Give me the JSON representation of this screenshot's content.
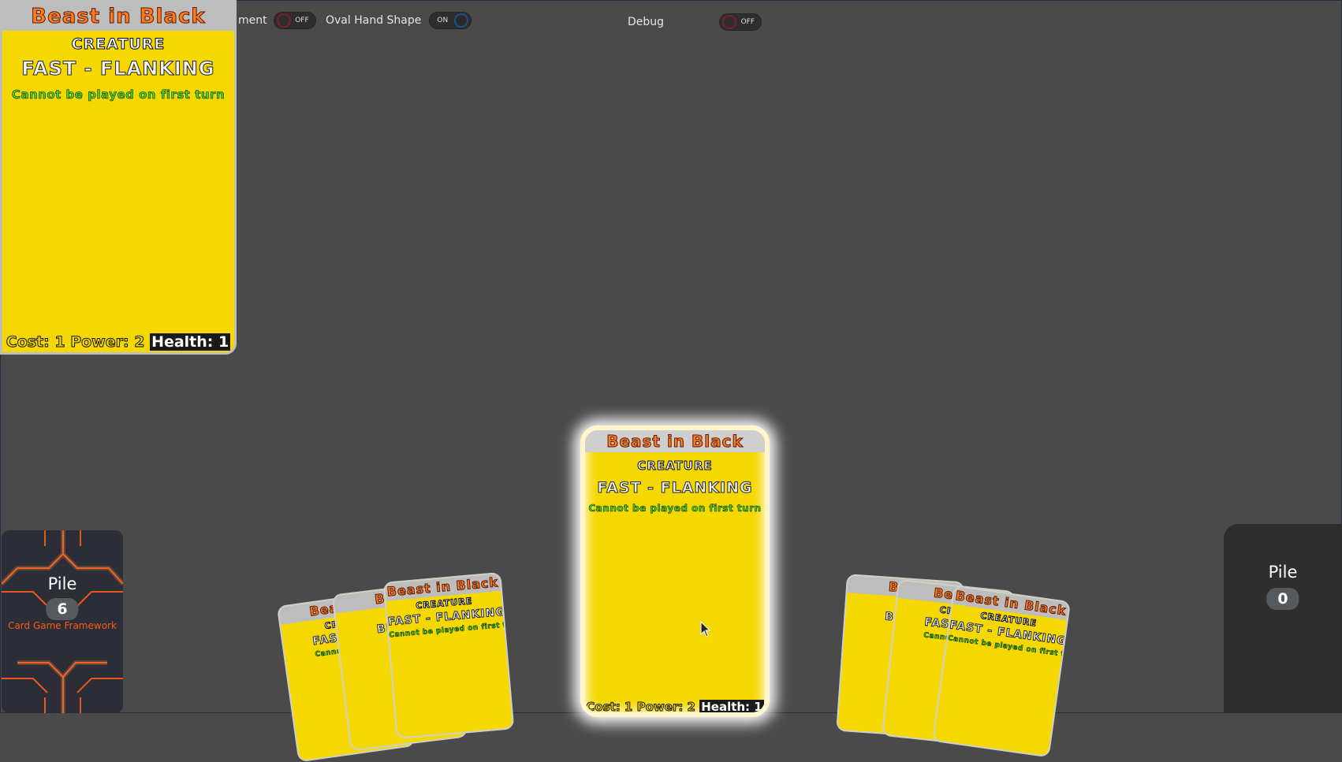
{
  "settings": {
    "toggle1": {
      "label": "ment",
      "state": "OFF"
    },
    "toggle2": {
      "label": "Oval Hand Shape",
      "state": "ON"
    },
    "toggle3": {
      "label": "Debug",
      "state": "OFF"
    }
  },
  "preview_card": {
    "name": "Beast in Black",
    "type": "CREATURE",
    "ability": "FAST - FLANKING",
    "rule": "Cannot be played on first turn",
    "stats": {
      "cost": "Cost: 1",
      "power": "Power: 2",
      "health": "Health: 1"
    }
  },
  "focused_card": {
    "name": "Beast in Black",
    "type": "CREATURE",
    "ability": "FAST - FLANKING",
    "rule": "Cannot be played on first turn",
    "stats": {
      "cost": "Cost: 1",
      "power": "Power: 2",
      "health": "Health: 1"
    }
  },
  "hand_left": [
    {
      "name": "Beast i",
      "type": "CREA",
      "ability": "FAST - F",
      "rule": "Cannot be pl"
    },
    {
      "name": "Batt",
      "type": "CR",
      "ability": "BRUT",
      "rule": ""
    },
    {
      "name": "Beast in Black",
      "type": "CREATURE",
      "ability": "FAST - FLANKING",
      "rule": "Cannot be played on first turn"
    }
  ],
  "hand_right": [
    {
      "name": "Batt",
      "type": "CR",
      "ability": "BRUT",
      "rule": ""
    },
    {
      "name": "Beast",
      "type": "CREA",
      "ability": "FAST - F",
      "rule": "Cannot be pl"
    },
    {
      "name": "Beast in Black",
      "type": "CREATURE",
      "ability": "FAST - FLANKING",
      "rule": "Cannot be played on first turn"
    }
  ],
  "deck_pile": {
    "title": "Pile",
    "count": "6",
    "brand": "Card Game Framework"
  },
  "discard_pile": {
    "title": "Pile",
    "count": "0"
  },
  "colors": {
    "background": "#4a4a4a",
    "card": "#f5d800",
    "name_text": "#ff7a1f",
    "rule_text": "#4cd421",
    "brand": "#ff5a1a"
  }
}
